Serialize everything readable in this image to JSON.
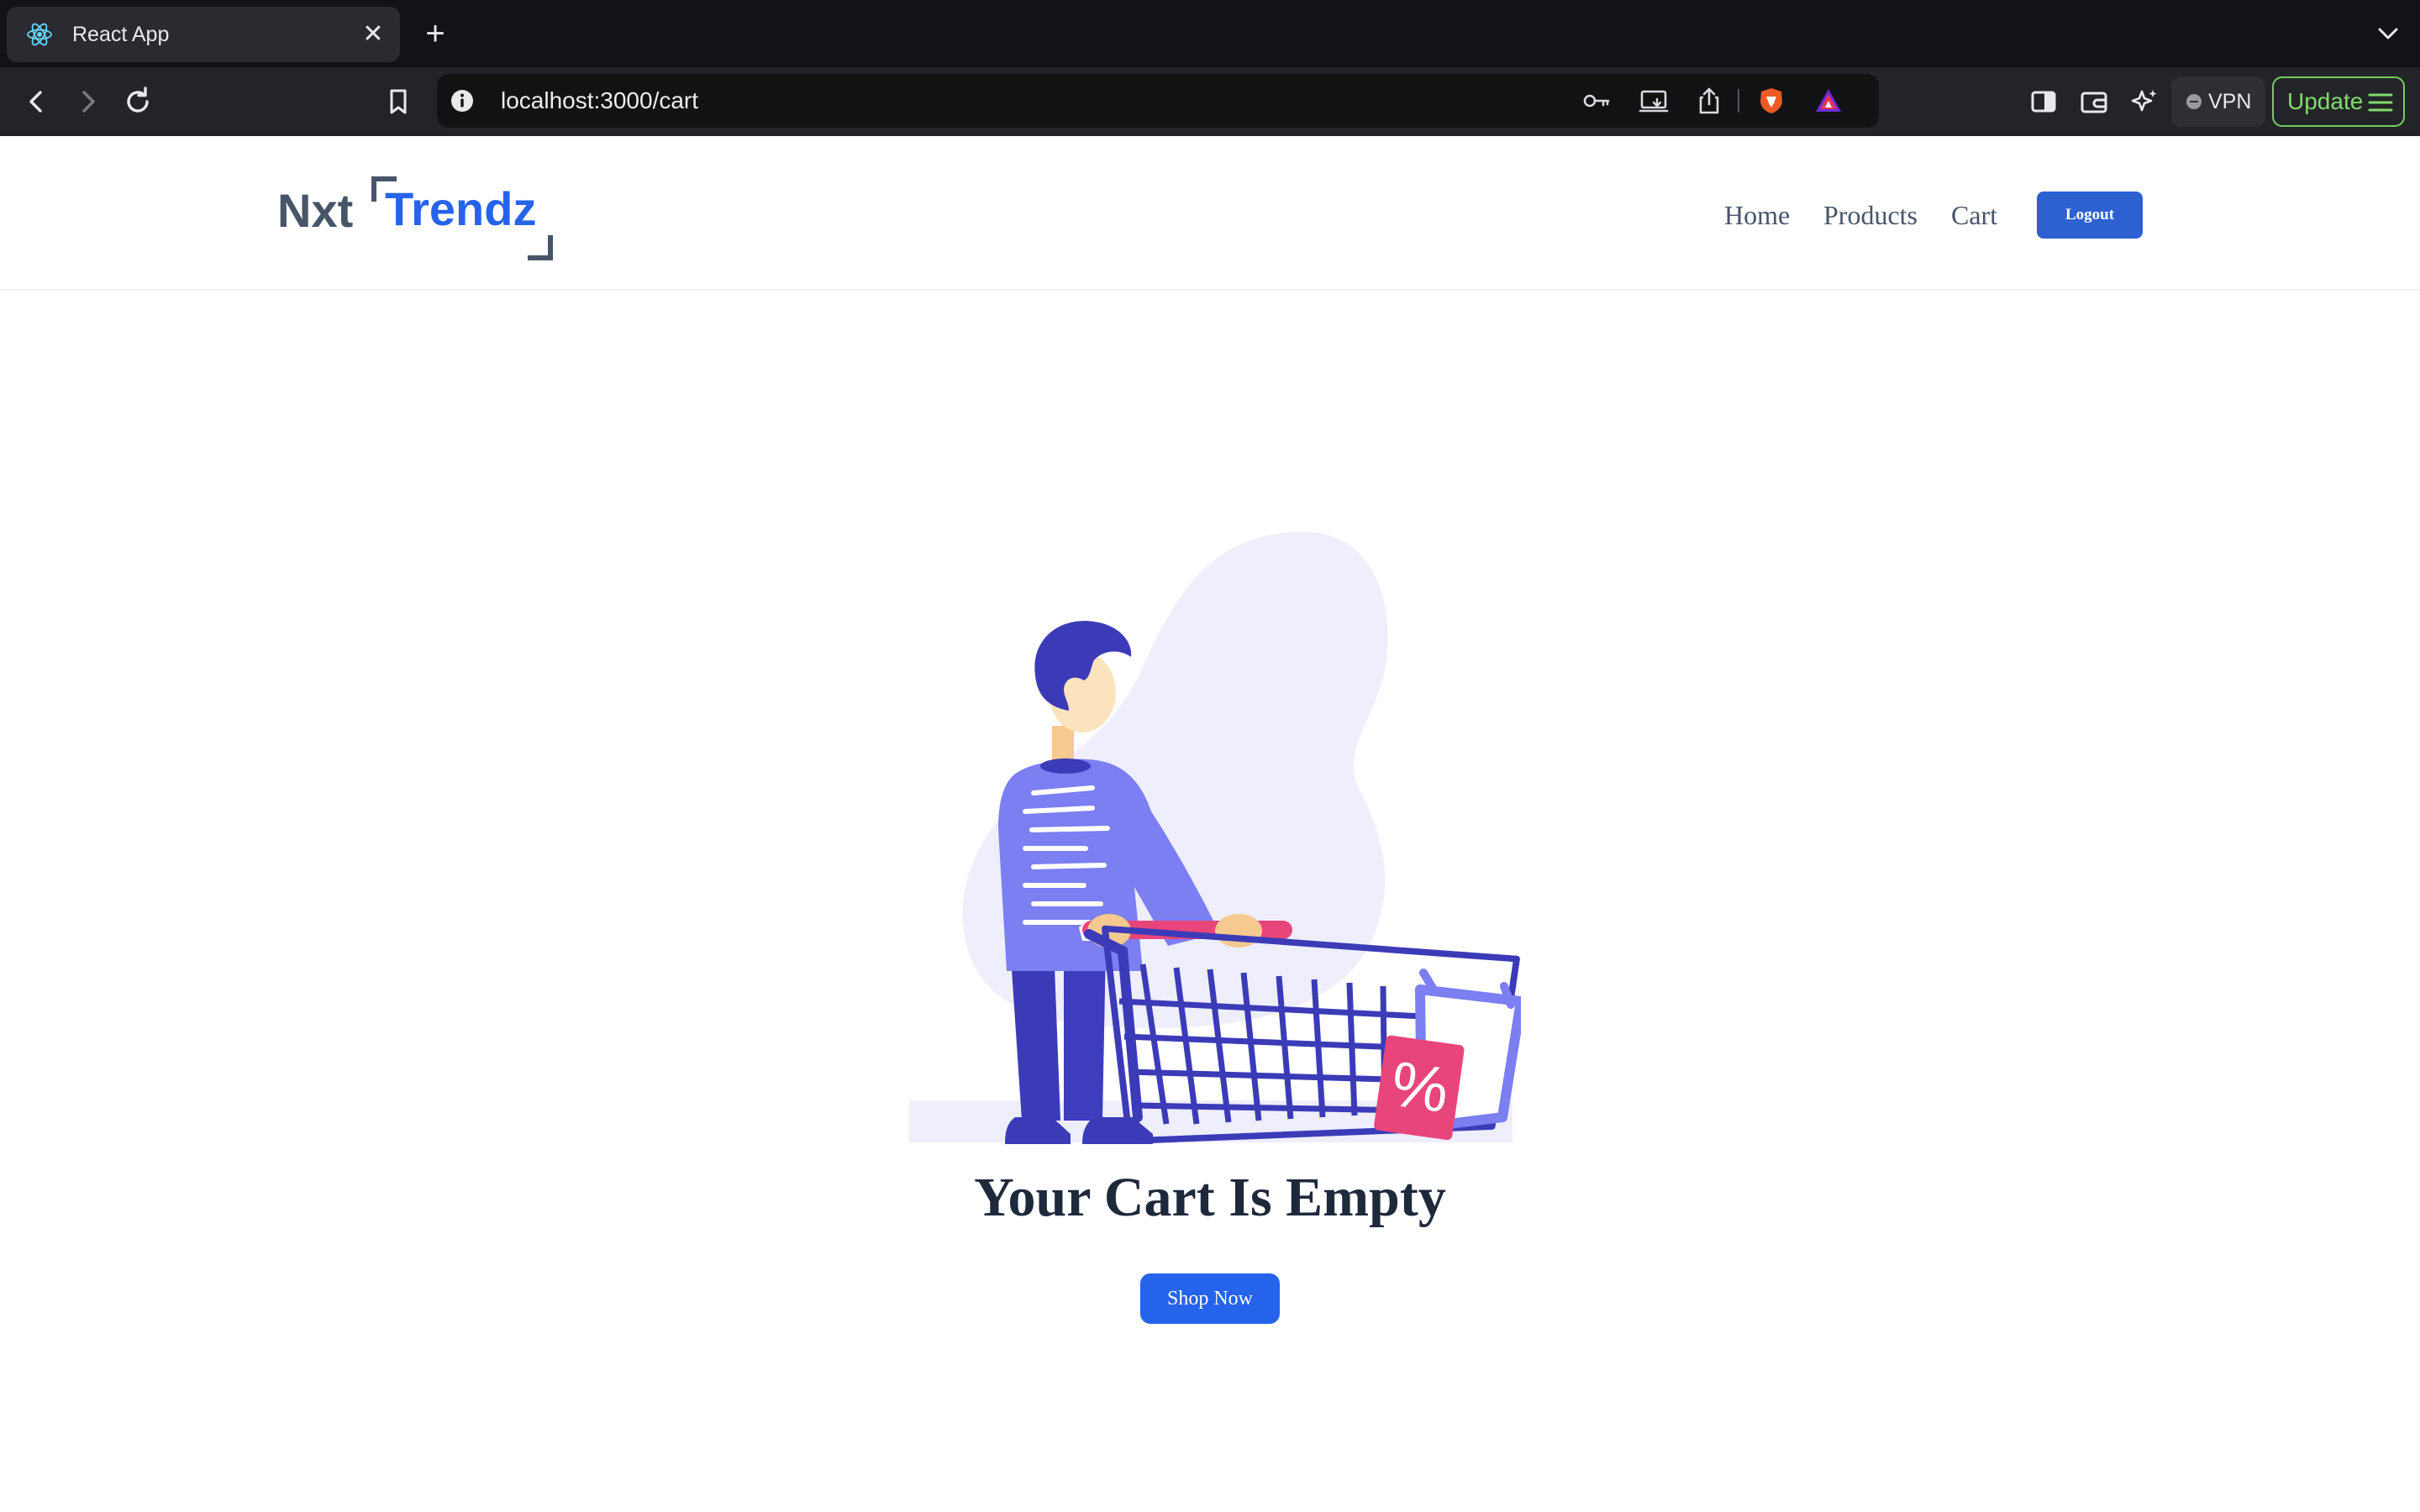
{
  "browser": {
    "tab_title": "React App",
    "tab_close": "✕",
    "new_tab": "+",
    "url": "localhost:3000/cart",
    "vpn_label": "VPN",
    "update_label": "Update"
  },
  "header": {
    "logo_first": "Nxt",
    "logo_second": "Trendz",
    "nav": {
      "home": "Home",
      "products": "Products",
      "cart": "Cart"
    },
    "logout_label": "Logout"
  },
  "cart": {
    "empty_title": "Your Cart Is Empty",
    "shop_now_label": "Shop Now",
    "badge_symbol": "%"
  },
  "colors": {
    "brand_blue": "#2563eb",
    "logout_blue": "#2d61d1",
    "logo_gray": "#475569",
    "illustration_purple": "#7b7ff2",
    "illustration_navy": "#3b3bb8",
    "illustration_pink": "#e8457a",
    "update_green": "#7fdc6a"
  }
}
